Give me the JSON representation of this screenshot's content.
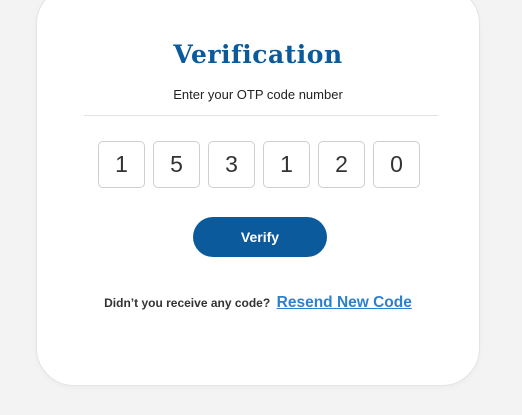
{
  "verification": {
    "title": "Verification",
    "subtitle": "Enter your OTP code number",
    "otp_digits": [
      "1",
      "5",
      "3",
      "1",
      "2",
      "0"
    ],
    "verify_label": "Verify",
    "resend_prompt": "Didn’t you receive any code?",
    "resend_link": "Resend New Code"
  },
  "colors": {
    "brand": "#0b5a9c",
    "link": "#2f7fcf",
    "background": "#f3f3f3",
    "card": "#ffffff"
  }
}
